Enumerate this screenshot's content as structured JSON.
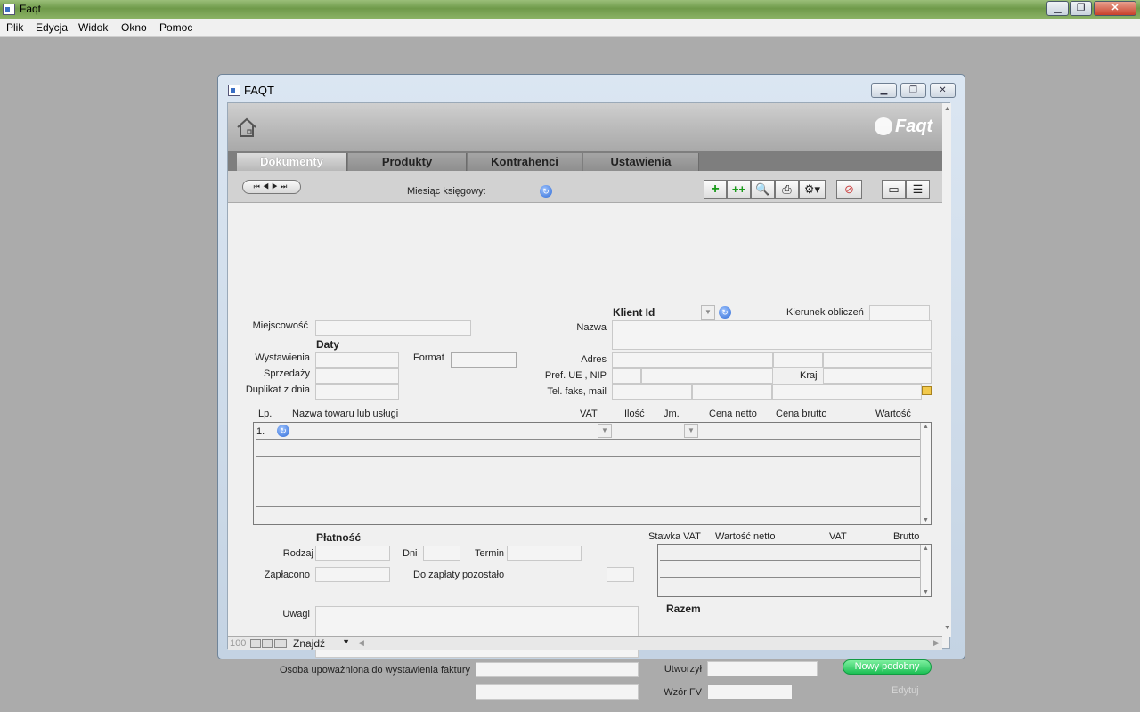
{
  "app": {
    "title": "Faqt"
  },
  "menubar": [
    "Plik",
    "Edycja",
    "Widok",
    "Okno",
    "Pomoc"
  ],
  "window": {
    "title": "FAQT",
    "logo": "Faqt"
  },
  "tabs": [
    "Dokumenty",
    "Produkty",
    "Kontrahenci",
    "Ustawienia"
  ],
  "toolbar": {
    "miesiac_label": "Miesiąc księgowy:"
  },
  "form": {
    "miejscowosc": "Miejscowość",
    "daty": "Daty",
    "wystawienia": "Wystawienia",
    "format": "Format",
    "sprzedazy": "Sprzedaży",
    "duplikat": "Duplikat z dnia",
    "klient_id": "Klient Id",
    "kierunek": "Kierunek obliczeń",
    "nazwa": "Nazwa",
    "adres": "Adres",
    "pref": "Pref. UE , NIP",
    "kraj": "Kraj",
    "tel": "Tel. faks, mail"
  },
  "items": {
    "columns": [
      "Lp.",
      "Nazwa towaru lub usługi",
      "VAT",
      "Ilość",
      "Jm.",
      "Cena netto",
      "Cena brutto",
      "Wartość"
    ],
    "first_lp": "1."
  },
  "payment": {
    "title": "Płatność",
    "rodzaj": "Rodzaj",
    "dni": "Dni",
    "termin": "Termin",
    "zaplacono": "Zapłacono",
    "do_zaplaty": "Do zapłaty pozostało",
    "uwagi": "Uwagi",
    "osoba": "Osoba upoważniona do wystawienia faktury"
  },
  "vat": {
    "columns": [
      "Stawka VAT",
      "Wartość netto",
      "VAT",
      "Brutto"
    ],
    "razem": "Razem"
  },
  "footer": {
    "utworzyl": "Utworzył",
    "wzor": "Wzór FV",
    "nowy_button": "Nowy podobny",
    "edytuj": "Edytuj"
  },
  "status": {
    "zoom": "100",
    "mode": "Znajdź"
  }
}
